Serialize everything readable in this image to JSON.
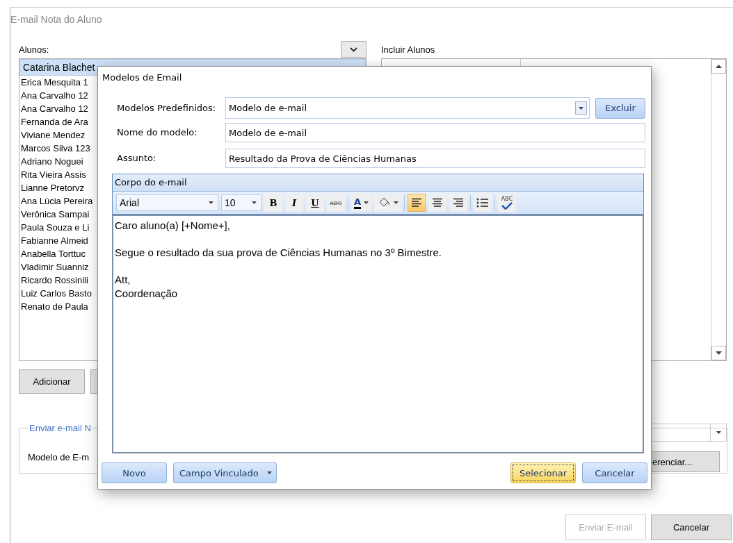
{
  "window": {
    "title": "E-mail Nota do Aluno"
  },
  "students": {
    "label": "Alunos:",
    "items": [
      {
        "name": "Catarina Blachet",
        "selected": true
      },
      {
        "name": "Erica Mesquita 1",
        "selected": false
      },
      {
        "name": "Ana Carvalho 12",
        "selected": false
      },
      {
        "name": "Ana Carvalho 12",
        "selected": false
      },
      {
        "name": "Fernanda de Ara",
        "selected": false
      },
      {
        "name": "Viviane Mendez",
        "selected": false
      },
      {
        "name": "Marcos Silva 123",
        "selected": false
      },
      {
        "name": "Adriano Noguei",
        "selected": false
      },
      {
        "name": "Rita Vieira Assis",
        "selected": false
      },
      {
        "name": "Lianne Pretorvz",
        "selected": false
      },
      {
        "name": "Ana Lúcia Pereira",
        "selected": false
      },
      {
        "name": "Verônica Sampai",
        "selected": false
      },
      {
        "name": "Paula Souza e Li",
        "selected": false
      },
      {
        "name": "Fabianne Almeid",
        "selected": false
      },
      {
        "name": "Anabella Torttuc",
        "selected": false
      },
      {
        "name": "Vladimir Suanniz",
        "selected": false
      },
      {
        "name": "Ricardo Rossinili",
        "selected": false
      },
      {
        "name": "Luiz Carlos Basto",
        "selected": false
      },
      {
        "name": "Renato de Paula",
        "selected": false
      }
    ],
    "add_button": "Adicionar"
  },
  "included": {
    "label": "Incluir Alunos"
  },
  "send_group": {
    "legend": "Enviar e-mail N",
    "template_label": "Modelo de E-m",
    "manage_button": "erenciar..."
  },
  "footer_buttons": [
    {
      "label": "Enviar E-mail",
      "disabled": true
    },
    {
      "label": "Cancelar",
      "disabled": false
    }
  ],
  "dialog": {
    "title": "Modelos de Email",
    "fields": [
      {
        "kind": "combo",
        "label": "Modelos Predefinidos:",
        "value": "Modelo de e-mail",
        "button": "Excluir"
      },
      {
        "kind": "text",
        "label": "Nome do modelo:",
        "value": "Modelo de e-mail"
      },
      {
        "kind": "text",
        "label": "Assunto:",
        "value": "Resultado da Prova de Ciências Humanas"
      }
    ],
    "body": {
      "title": "Corpo do e-mail",
      "font": "Arial",
      "size": "10",
      "tools": [
        {
          "kind": "bold",
          "label": "B",
          "selected": false
        },
        {
          "kind": "italic",
          "label": "I",
          "selected": false
        },
        {
          "kind": "underline",
          "label": "U",
          "selected": false
        },
        {
          "kind": "strike",
          "label": "ABC",
          "selected": false
        },
        {
          "kind": "color",
          "label": "A",
          "selected": false
        },
        {
          "kind": "fill",
          "selected": false
        },
        {
          "kind": "align-left",
          "selected": true
        },
        {
          "kind": "align-center",
          "selected": false
        },
        {
          "kind": "align-right",
          "selected": false
        },
        {
          "kind": "bullets",
          "selected": false
        },
        {
          "kind": "spell",
          "label": "ABC"
        }
      ],
      "paragraphs": [
        [
          "Caro aluno(a) [+Nome+],"
        ],
        [
          "Segue o resultado da sua prova de Ciências Humanas no 3º Bimestre."
        ],
        [
          "Att,",
          "Coordenação"
        ]
      ]
    },
    "buttons": [
      {
        "kind": "plain",
        "label": "Novo",
        "focused": false
      },
      {
        "kind": "dropdown",
        "label": "Campo Vinculado",
        "focused": false
      },
      {
        "kind": "plain",
        "label": "Selecionar",
        "focused": true
      },
      {
        "kind": "plain",
        "label": "Cancelar",
        "focused": false
      }
    ]
  }
}
